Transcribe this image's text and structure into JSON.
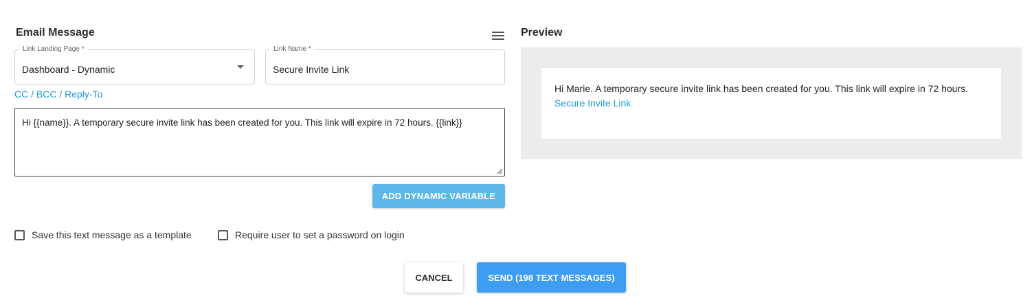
{
  "email": {
    "title": "Email Message",
    "menu_icon": "hamburger-menu-icon",
    "landing_page": {
      "label": "Link Landing Page *",
      "value": "Dashboard - Dynamic"
    },
    "link_name": {
      "label": "Link Name *",
      "value": "Secure Invite Link"
    },
    "cc_link": "CC / BCC / Reply-To",
    "message": "Hi {{name}}. A temporary secure invite link has been created for you. This link will expire in 72 hours. {{link}}",
    "add_variable_label": "ADD DYNAMIC VARIABLE"
  },
  "options": {
    "save_template_label": "Save this text message as a template",
    "require_password_label": "Require user to set a password on login"
  },
  "actions": {
    "cancel_label": "CANCEL",
    "send_label": "SEND (198 TEXT MESSAGES)"
  },
  "preview": {
    "title": "Preview",
    "body_text": "Hi Marie. A temporary secure invite link has been created for you. This link will expire in 72 hours.",
    "link_text": "Secure Invite Link"
  },
  "colors": {
    "link": "#1e9bd7",
    "primary_button": "#3d9df2",
    "secondary_button": "#5cb8e8",
    "preview_background": "#ebecee"
  }
}
